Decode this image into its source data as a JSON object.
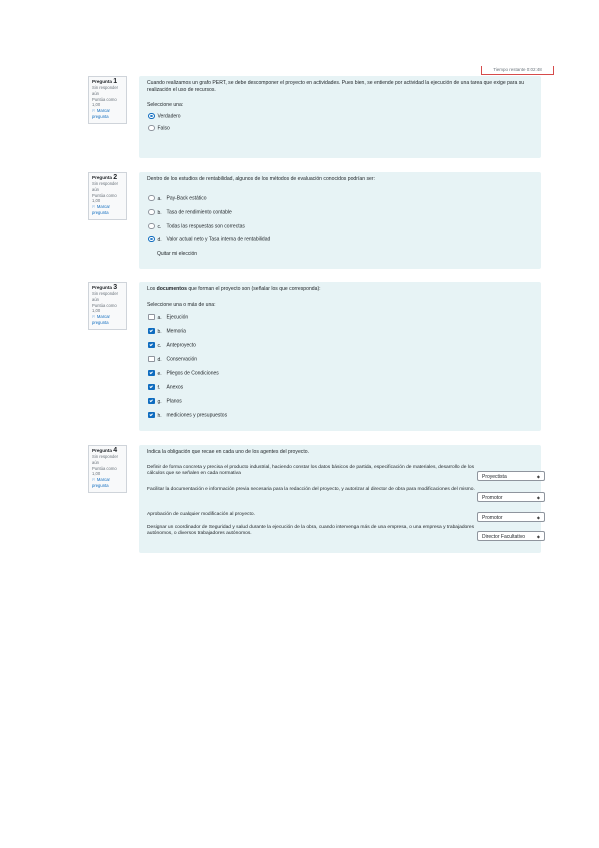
{
  "timer": {
    "label": "Tiempo restante 0:02:48"
  },
  "questions": [
    {
      "prefix": "Pregunta",
      "number": "1",
      "status": "Sin responder aún",
      "score": "Puntúa como 1,00",
      "flag": "Marcar pregunta",
      "text": "Cuando realizamos un grafo PERT, se debe descomponer el proyecto en actividades. Pues bien, se entiende por actividad la ejecución de una tarea que exige para su realización el uso de recursos.",
      "prompt": "Seleccione una:",
      "options": [
        {
          "label": "Verdadero",
          "checked": true
        },
        {
          "label": "Falso",
          "checked": false
        }
      ]
    },
    {
      "prefix": "Pregunta",
      "number": "2",
      "status": "Sin responder aún",
      "score": "Puntúa como 1,00",
      "flag": "Marcar pregunta",
      "text": "Dentro de los estudios de rentabilidad, algunos de los métodos de evaluación conocidos podrían ser:",
      "options": [
        {
          "letter": "a.",
          "label": "Pay-Back estático",
          "checked": false
        },
        {
          "letter": "b.",
          "label": "Tasa de rendimiento contable",
          "checked": false
        },
        {
          "letter": "c.",
          "label": "Todas las respuestas son correctas",
          "checked": false
        },
        {
          "letter": "d.",
          "label": "Valor actual neto y Tasa interna de rentabilidad",
          "checked": true
        }
      ],
      "clear": "Quitar mi elección"
    },
    {
      "prefix": "Pregunta",
      "number": "3",
      "status": "Sin responder aún",
      "score": "Puntúa como 1,00",
      "flag": "Marcar pregunta",
      "text_bold": "documentos",
      "text_before": "Los ",
      "text_after": " que forman el proyecto son (señalar los que corresponda):",
      "prompt": "Seleccione una o más de una:",
      "options": [
        {
          "letter": "a.",
          "label": "Ejecución",
          "checked": false
        },
        {
          "letter": "b.",
          "label": "Memoria",
          "checked": true
        },
        {
          "letter": "c.",
          "label": "Anteproyecto",
          "checked": true
        },
        {
          "letter": "d.",
          "label": "Conservación",
          "checked": false
        },
        {
          "letter": "e.",
          "label": "Pliegos de Condiciones",
          "checked": true
        },
        {
          "letter": "f.",
          "label": "Anexos",
          "checked": true
        },
        {
          "letter": "g.",
          "label": "Planos",
          "checked": true
        },
        {
          "letter": "h.",
          "label": "mediciones y presupuestos",
          "checked": true
        }
      ]
    },
    {
      "prefix": "Pregunta",
      "number": "4",
      "status": "Sin responder aún",
      "score": "Puntúa como 1,00",
      "flag": "Marcar pregunta",
      "text": "Indica la obligación que recae en cada uno de los agentes del proyecto.",
      "rows": [
        {
          "text": "Definir de forma concreta y precisa el producto industrial, haciendo constar los datos básicos de partida, especificación de materiales, desarrollo de los cálculos que se señalen en cada normativa",
          "selected": "Proyectista"
        },
        {
          "text": "Facilitar la documentación e información previa necesaria para la redacción del proyecto, y autorizar al director de obra para modificaciones del mismo.",
          "selected": "Promotor"
        },
        {
          "text": "Aprobación de cualquier modificación al proyecto.",
          "selected": "Promotor"
        },
        {
          "text": "Designar un coordinador de Seguridad y salud durante la ejecución de la obra, cuando intervenga más de una empresa, o una empresa y trabajadores autónomos, o diversos trabajadores autónomos.",
          "selected": "Director Facultativo"
        }
      ]
    }
  ],
  "icons": {
    "flag": "flag-icon",
    "select_arrow": "chevron-updown-icon"
  }
}
